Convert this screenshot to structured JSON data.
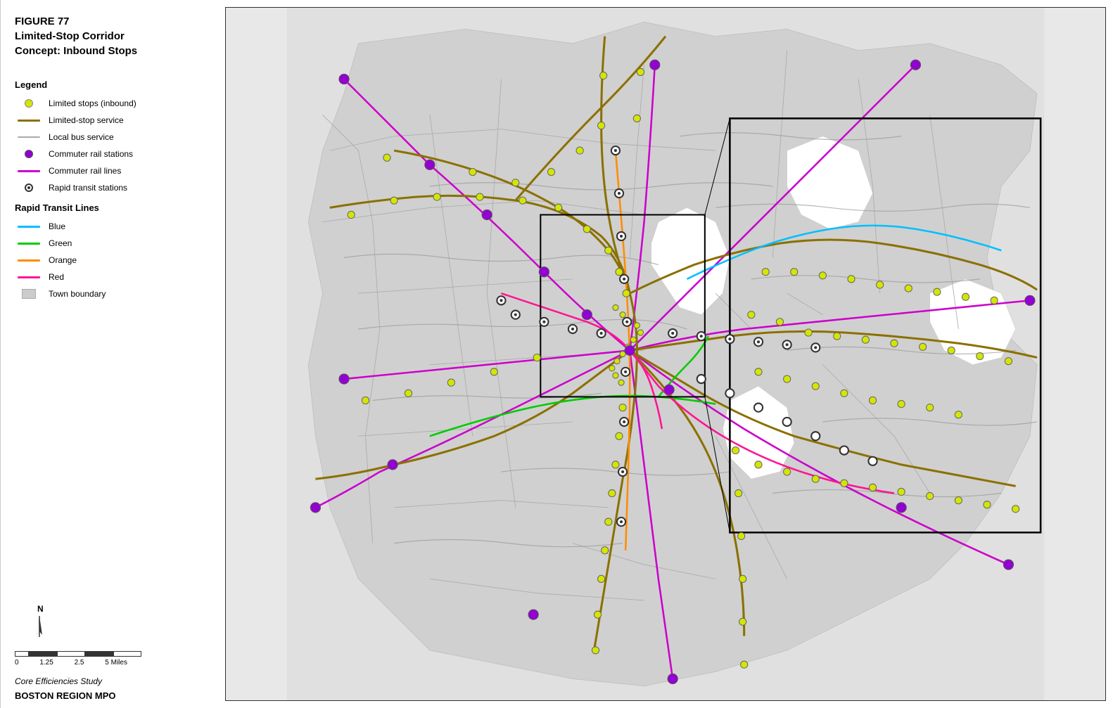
{
  "figure": {
    "number": "FIGURE 77",
    "title_line1": "Limited-Stop Corridor",
    "title_line2": "Concept: Inbound Stops"
  },
  "legend": {
    "title": "Legend",
    "items": [
      {
        "id": "limited-stops",
        "label": "Limited stops (inbound)",
        "type": "circle-yellow"
      },
      {
        "id": "limited-stop-service",
        "label": "Limited-stop service",
        "type": "line-dark-yellow"
      },
      {
        "id": "local-bus-service",
        "label": "Local bus service",
        "type": "line-gray"
      },
      {
        "id": "commuter-rail-stations",
        "label": "Commuter rail stations",
        "type": "circle-purple"
      },
      {
        "id": "commuter-rail-lines",
        "label": "Commuter rail lines",
        "type": "line-magenta"
      },
      {
        "id": "rapid-transit-stations",
        "label": "Rapid transit stations",
        "type": "circle-transit"
      }
    ],
    "rapid_transit": {
      "title": "Rapid Transit Lines",
      "lines": [
        {
          "color": "#00bfff",
          "label": "Blue"
        },
        {
          "color": "#00c800",
          "label": "Green"
        },
        {
          "color": "#ff8c00",
          "label": "Orange"
        },
        {
          "color": "#ff1493",
          "label": "Red"
        }
      ]
    },
    "town_boundary": {
      "label": "Town boundary",
      "type": "gray-box"
    }
  },
  "scale": {
    "values": [
      "0",
      "1.25",
      "2.5",
      "5 Miles"
    ]
  },
  "footer": {
    "study": "Core Efficiencies Study",
    "org": "BOSTON REGION MPO"
  },
  "colors": {
    "limited_stop_line": "#8B7000",
    "local_bus": "#999999",
    "commuter_rail": "#cc00cc",
    "blue_line": "#00bfff",
    "green_line": "#00cc00",
    "orange_line": "#ff8c00",
    "red_line": "#ff1493",
    "town_fill": "#cccccc",
    "map_background": "#e0e0e0"
  }
}
